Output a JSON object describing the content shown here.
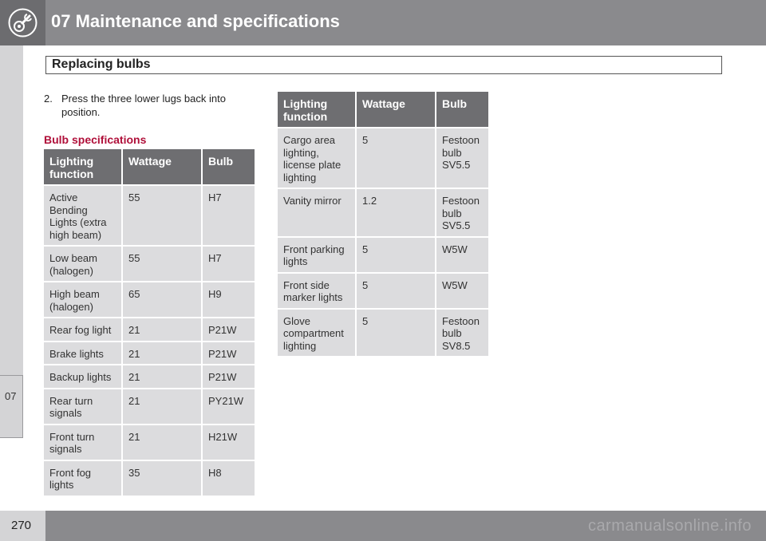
{
  "header": {
    "chapter_title": "07 Maintenance and specifications",
    "icon": "wrench-gear-icon"
  },
  "section": {
    "title": "Replacing bulbs"
  },
  "sidebar": {
    "chapter_tab": "07"
  },
  "step": {
    "number": "2.",
    "text": "Press the three lower lugs back into position."
  },
  "subheading": "Bulb specifications",
  "table_left": {
    "headers": [
      "Lighting function",
      "Wattage",
      "Bulb"
    ],
    "rows": [
      [
        "Active Bending Lights (extra high beam)",
        "55",
        "H7"
      ],
      [
        "Low beam (halogen)",
        "55",
        "H7"
      ],
      [
        "High beam (halogen)",
        "65",
        "H9"
      ],
      [
        "Rear fog light",
        "21",
        "P21W"
      ],
      [
        "Brake lights",
        "21",
        "P21W"
      ],
      [
        "Backup lights",
        "21",
        "P21W"
      ],
      [
        "Rear turn signals",
        "21",
        "PY21W"
      ],
      [
        "Front turn signals",
        "21",
        "H21W"
      ],
      [
        "Front fog lights",
        "35",
        "H8"
      ]
    ]
  },
  "table_right": {
    "headers": [
      "Lighting function",
      "Wattage",
      "Bulb"
    ],
    "rows": [
      [
        "Cargo area lighting, license plate lighting",
        "5",
        "Festoon bulb SV5.5"
      ],
      [
        "Vanity mirror",
        "1.2",
        "Festoon bulb SV5.5"
      ],
      [
        "Front parking lights",
        "5",
        "W5W"
      ],
      [
        "Front side marker lights",
        "5",
        "W5W"
      ],
      [
        "Glove compartment lighting",
        "5",
        "Festoon bulb SV8.5"
      ]
    ]
  },
  "footer": {
    "page_number": "270",
    "watermark": "carmanualsonline.info"
  },
  "colors": {
    "header_bar": "#8a8a8d",
    "table_header": "#6e6e71",
    "table_cell": "#dcdcde",
    "subheading": "#b0103a"
  }
}
